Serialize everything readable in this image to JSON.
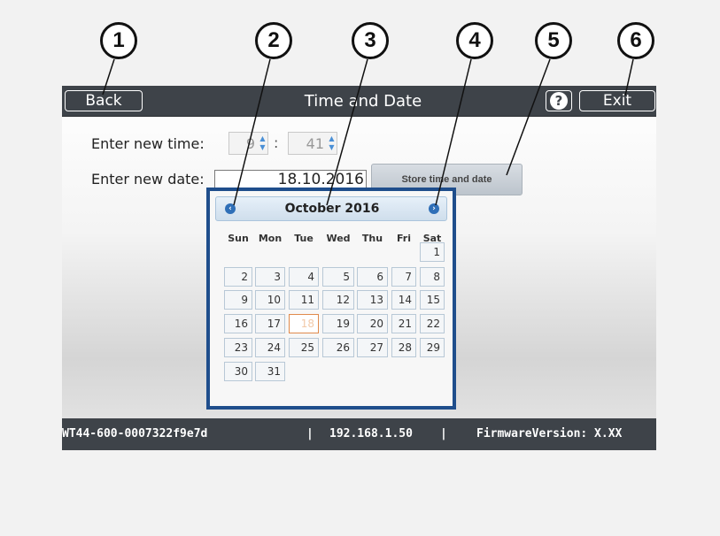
{
  "callouts": [
    "1",
    "2",
    "3",
    "4",
    "5",
    "6"
  ],
  "titlebar": {
    "back_label": "Back",
    "title": "Time and Date",
    "help_label": "?",
    "exit_label": "Exit"
  },
  "form": {
    "time_label": "Enter new time:",
    "hour_value": "9",
    "colon": ":",
    "minute_value": "41",
    "date_label": "Enter new date:",
    "date_value": "18.10.2016",
    "store_label": "Store time and date"
  },
  "calendar": {
    "month_title": "October 2016",
    "prev_icon": "chevron-left-icon",
    "next_icon": "chevron-right-icon",
    "weekdays": [
      "Sun",
      "Mon",
      "Tue",
      "Wed",
      "Thu",
      "Fri",
      "Sat"
    ],
    "weeks": [
      [
        "",
        "",
        "",
        "",
        "",
        "",
        "1"
      ],
      [
        "2",
        "3",
        "4",
        "5",
        "6",
        "7",
        "8"
      ],
      [
        "9",
        "10",
        "11",
        "12",
        "13",
        "14",
        "15"
      ],
      [
        "16",
        "17",
        "18",
        "19",
        "20",
        "21",
        "22"
      ],
      [
        "23",
        "24",
        "25",
        "26",
        "27",
        "28",
        "29"
      ],
      [
        "30",
        "31",
        "",
        "",
        "",
        "",
        ""
      ]
    ],
    "selected_day": "18"
  },
  "footer": {
    "device_id": "WT44-600-0007322f9e7d",
    "sep1": "|",
    "ip": "192.168.1.50",
    "sep2": "|",
    "firmware": "FirmwareVersion: X.XX"
  },
  "colors": {
    "bar": "#3e4349",
    "calendar_border": "#1f4e8c",
    "today_border": "#e08a4c"
  }
}
